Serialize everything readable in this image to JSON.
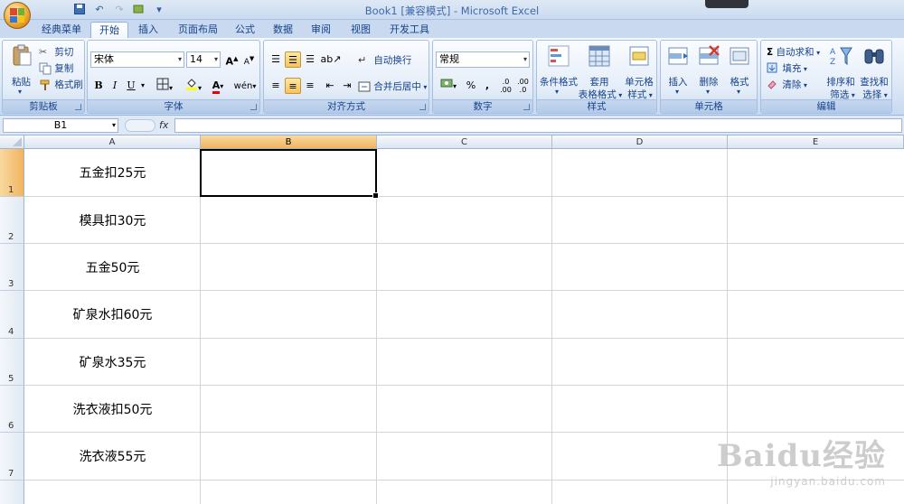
{
  "window": {
    "title_doc": "Book1  [兼容模式]",
    "title_sep": " - ",
    "title_app": "Microsoft Excel"
  },
  "tabs": [
    "经典菜单",
    "开始",
    "插入",
    "页面布局",
    "公式",
    "数据",
    "审阅",
    "视图",
    "开发工具"
  ],
  "ribbon": {
    "clipboard": {
      "label": "剪贴板",
      "paste": "粘贴",
      "cut": "剪切",
      "copy": "复制",
      "format_painter": "格式刷"
    },
    "font": {
      "label": "字体",
      "font_name": "宋体",
      "font_size": "14",
      "bold": "B",
      "italic": "I",
      "underline": "U"
    },
    "alignment": {
      "label": "对齐方式",
      "wrap": "自动换行",
      "merge": "合并后居中"
    },
    "number": {
      "label": "数字",
      "format": "常规",
      "percent": "%",
      "comma": ",",
      "inc_dec": ".0 .00",
      "dec_dec": ".00 .0"
    },
    "styles": {
      "label": "样式",
      "conditional": "条件格式",
      "table_1": "套用",
      "table_2": "表格格式",
      "cell_style_1": "单元格",
      "cell_style_2": "样式"
    },
    "cells": {
      "label": "单元格",
      "insert": "插入",
      "delete": "删除",
      "format": "格式"
    },
    "editing": {
      "label": "编辑",
      "autosum": "自动求和",
      "fill": "填充",
      "clear": "清除",
      "sort_1": "排序和",
      "sort_2": "筛选",
      "find_1": "查找和",
      "find_2": "选择"
    }
  },
  "formula_bar": {
    "name_box": "B1",
    "fx": "fx",
    "content": ""
  },
  "sheet": {
    "columns": [
      "A",
      "B",
      "C",
      "D",
      "E"
    ],
    "selected_column": "B",
    "selected_row": "1",
    "rows": [
      {
        "num": "1",
        "a": "五金扣25元"
      },
      {
        "num": "2",
        "a": "模具扣30元"
      },
      {
        "num": "3",
        "a": "五金50元"
      },
      {
        "num": "4",
        "a": "矿泉水扣60元"
      },
      {
        "num": "5",
        "a": "矿泉水35元"
      },
      {
        "num": "6",
        "a": "洗衣液扣50元"
      },
      {
        "num": "7",
        "a": "洗衣液55元"
      }
    ]
  },
  "watermark": {
    "logo": "Baidu经验",
    "url": "jingyan.baidu.com"
  }
}
